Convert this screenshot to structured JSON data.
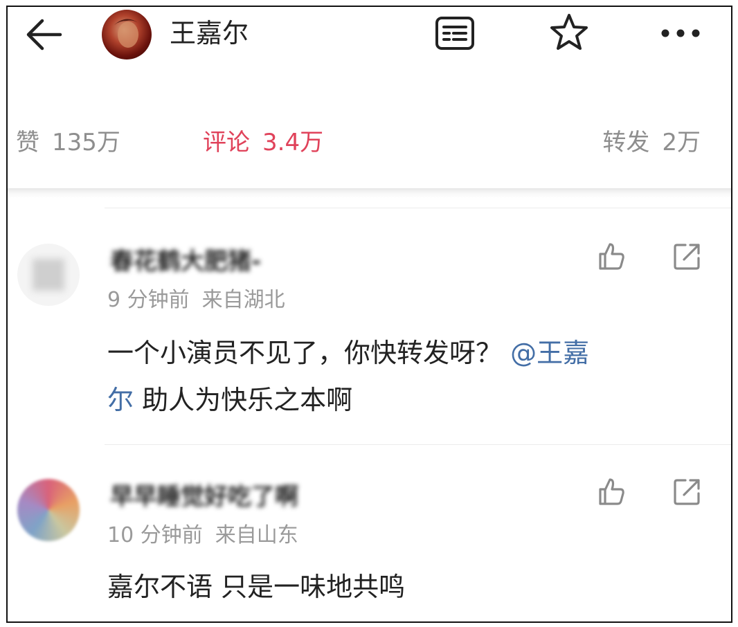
{
  "header": {
    "title": "王嘉尔",
    "icons": [
      "back-arrow-icon",
      "profile-avatar",
      "list-menu-icon",
      "star-icon",
      "more-icon"
    ]
  },
  "stats": {
    "likes_label": "赞",
    "likes_count": "135万",
    "comments_label": "评论",
    "comments_count": "3.4万",
    "reposts_label": "转发",
    "reposts_count": "2万",
    "active_color": "#e0425a"
  },
  "comments": [
    {
      "username": "春花鹤大肥猪-",
      "time": "9 分钟前",
      "location": "来自湖北",
      "text_line1": "一个小演员不见了，你快转发呀？",
      "mention_part1": "@王嘉",
      "mention_part2": "尔",
      "text_line2": "助人为快乐之本啊"
    },
    {
      "username": "早早睡觉好吃了啊",
      "time": "10 分钟前",
      "location": "来自山东",
      "text": "嘉尔不语 只是一味地共鸣"
    }
  ],
  "colors": {
    "mention": "#436ea6",
    "muted": "#8e8e8e"
  }
}
